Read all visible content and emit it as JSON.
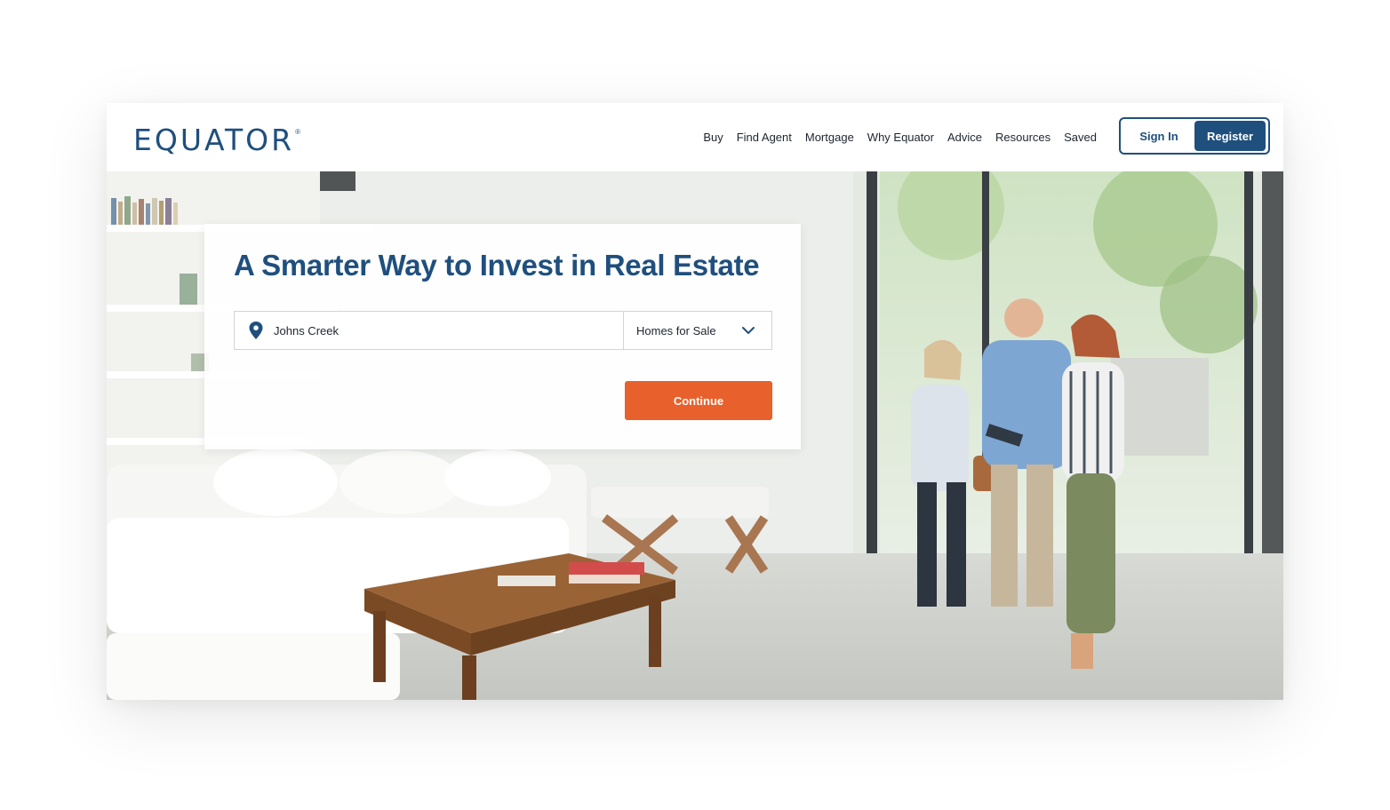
{
  "brand": {
    "logo_text": "EQUATOR",
    "logo_mark": "®"
  },
  "nav": {
    "items": [
      {
        "label": "Buy"
      },
      {
        "label": "Find Agent"
      },
      {
        "label": "Mortgage"
      },
      {
        "label": "Why Equator"
      },
      {
        "label": "Advice"
      },
      {
        "label": "Resources"
      },
      {
        "label": "Saved"
      }
    ]
  },
  "auth": {
    "sign_in": "Sign In",
    "register": "Register"
  },
  "hero": {
    "title": "A Smarter Way to Invest in Real Estate",
    "search": {
      "location_value": "Johns Creek",
      "location_icon": "map-pin-icon",
      "type_value": "Homes for Sale",
      "type_icon": "chevron-down-icon"
    },
    "continue_label": "Continue",
    "photo_subject": "hero-photo"
  },
  "colors": {
    "brand_blue": "#1f4f7d",
    "accent_orange": "#e8602c",
    "text_dark": "#1e2530"
  }
}
